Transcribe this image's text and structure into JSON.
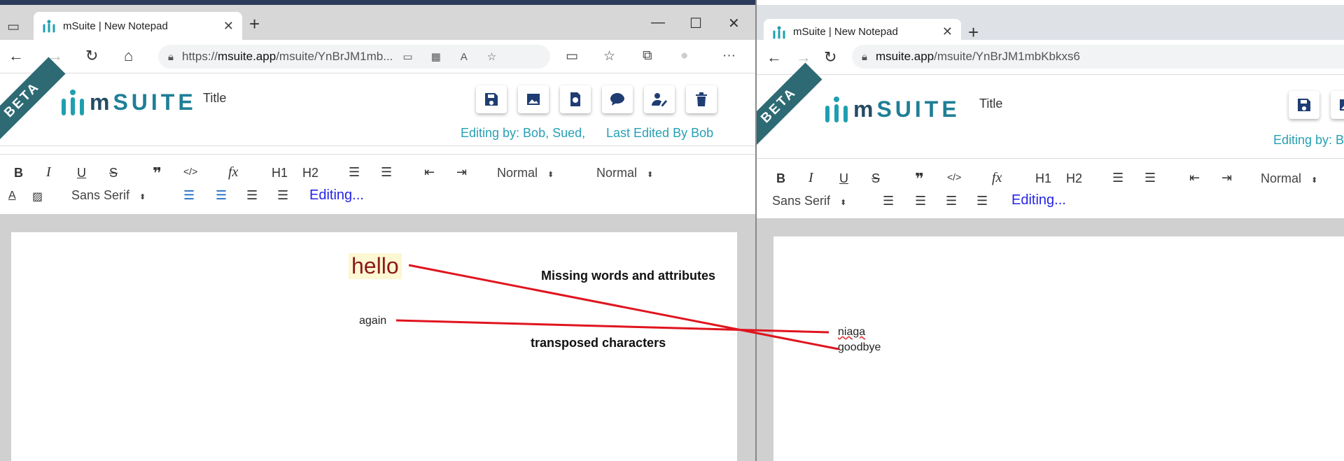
{
  "left": {
    "tab_title": "mSuite | New Notepad",
    "url_prefix": "https://",
    "url_domain": "msuite.app",
    "url_path": "/msuite/YnBrJM1mb...",
    "doc_title": "Title",
    "editing_by": "Editing by: Bob, Sued,",
    "last_edited": "Last Edited By Bob",
    "toolbar": {
      "header1": "H1",
      "header2": "H2",
      "size_select": "Normal",
      "header_select": "Normal",
      "font_select": "Sans Serif",
      "status": "Editing..."
    },
    "content": {
      "word1": "hello",
      "word2": "again"
    }
  },
  "right": {
    "tab_title": "mSuite | New Notepad",
    "url_domain": "msuite.app",
    "url_path": "/msuite/YnBrJM1mbKbkxs6",
    "doc_title": "Title",
    "editing_by": "Editing by: B",
    "toolbar": {
      "header1": "H1",
      "header2": "H2",
      "size_select": "Normal",
      "font_select": "Sans Serif",
      "status": "Editing..."
    },
    "content": {
      "word1": "niaga",
      "word2": "goodbye"
    }
  },
  "logo": {
    "brand_prefix": "m",
    "brand_suffix": "SUITE",
    "beta": "BETA"
  },
  "annotations": {
    "missing": "Missing words and attributes",
    "transposed": "transposed characters"
  },
  "colors": {
    "accent": "#27a0b4",
    "brand_dark": "#1f3d73",
    "annotation_line": "#e0141e",
    "hello_text": "#8b1a1a",
    "hello_highlight": "#fdf7d2"
  }
}
